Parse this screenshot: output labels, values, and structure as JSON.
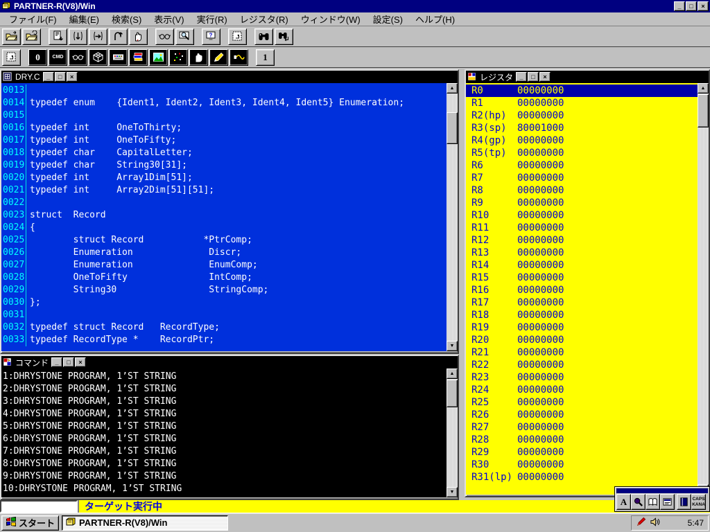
{
  "app": {
    "title": "PARTNER-R(V8)/Win"
  },
  "window_controls": {
    "minimize": "_",
    "maximize": "□",
    "restore": "□",
    "close": "×"
  },
  "menu": {
    "items": [
      {
        "name": "file",
        "label": "ファイル(F)"
      },
      {
        "name": "edit",
        "label": "編集(E)"
      },
      {
        "name": "search",
        "label": "検索(S)"
      },
      {
        "name": "view",
        "label": "表示(V)"
      },
      {
        "name": "run",
        "label": "実行(R)"
      },
      {
        "name": "register",
        "label": "レジスタ(R)"
      },
      {
        "name": "window",
        "label": "ウィンドウ(W)"
      },
      {
        "name": "config",
        "label": "設定(S)"
      },
      {
        "name": "help",
        "label": "ヘルプ(H)"
      }
    ]
  },
  "toolbar_row1": {
    "buttons": [
      {
        "name": "open-file",
        "icon": "open-file-icon"
      },
      {
        "name": "reload-file",
        "icon": "reload-file-icon"
      },
      {
        "name": "download",
        "icon": "download-icon",
        "gap": true
      },
      {
        "name": "step-into",
        "icon": "step-into-icon"
      },
      {
        "name": "step-over",
        "icon": "step-over-icon"
      },
      {
        "name": "step-out",
        "icon": "step-out-icon"
      },
      {
        "name": "stop",
        "icon": "stop-hand-icon"
      },
      {
        "name": "watch",
        "icon": "watch-glasses-icon",
        "gap": true
      },
      {
        "name": "inspect",
        "icon": "inspect-magnifier-icon"
      },
      {
        "name": "monitor-help",
        "icon": "monitor-help-icon",
        "gap": true
      },
      {
        "name": "window-layout",
        "icon": "window-layout-icon",
        "gap": true
      },
      {
        "name": "find",
        "icon": "find-binoculars-icon",
        "gap": true
      },
      {
        "name": "find-next",
        "icon": "find-next-icon"
      }
    ]
  },
  "toolbar_row2": {
    "buttons": [
      {
        "name": "window-layout-2",
        "icon": "window-layout-icon"
      },
      {
        "name": "zero-view",
        "label": "0",
        "dark": true,
        "gap": true
      },
      {
        "name": "command-view",
        "label": "CMD",
        "tiny": true,
        "dark": true
      },
      {
        "name": "watch-view",
        "icon": "watch-dark-icon",
        "dark": true
      },
      {
        "name": "memory-view",
        "icon": "memory-mesh-icon",
        "dark": true
      },
      {
        "name": "dump-view",
        "icon": "dump-keyboard-icon",
        "dark": true
      },
      {
        "name": "register-view",
        "icon": "register-books-icon",
        "dark": true
      },
      {
        "name": "bitmap-view",
        "icon": "bitmap-landscape-icon",
        "dark": true
      },
      {
        "name": "trace-view",
        "icon": "trace-dots-icon",
        "dark": true
      },
      {
        "name": "break-view",
        "icon": "hand-dark-icon",
        "dark": true
      },
      {
        "name": "edit-view",
        "icon": "edit-pencil-icon",
        "dark": true
      },
      {
        "name": "io-view",
        "icon": "io-ribbon-icon",
        "dark": true
      },
      {
        "name": "one-view",
        "label": "1",
        "gap": true
      }
    ]
  },
  "source_window": {
    "title": "DRY.C",
    "lines": [
      {
        "no": "0013",
        "code": ""
      },
      {
        "no": "0014",
        "code": "typedef enum    {Ident1, Ident2, Ident3, Ident4, Ident5} Enumeration;"
      },
      {
        "no": "0015",
        "code": ""
      },
      {
        "no": "0016",
        "code": "typedef int     OneToThirty;"
      },
      {
        "no": "0017",
        "code": "typedef int     OneToFifty;"
      },
      {
        "no": "0018",
        "code": "typedef char    CapitalLetter;"
      },
      {
        "no": "0019",
        "code": "typedef char    String30[31];"
      },
      {
        "no": "0020",
        "code": "typedef int     Array1Dim[51];"
      },
      {
        "no": "0021",
        "code": "typedef int     Array2Dim[51][51];"
      },
      {
        "no": "0022",
        "code": ""
      },
      {
        "no": "0023",
        "code": "struct  Record"
      },
      {
        "no": "0024",
        "code": "{"
      },
      {
        "no": "0025",
        "code": "        struct Record           *PtrComp;"
      },
      {
        "no": "0026",
        "code": "        Enumeration              Discr;"
      },
      {
        "no": "0027",
        "code": "        Enumeration              EnumComp;"
      },
      {
        "no": "0028",
        "code": "        OneToFifty               IntComp;"
      },
      {
        "no": "0029",
        "code": "        String30                 StringComp;"
      },
      {
        "no": "0030",
        "code": "};"
      },
      {
        "no": "0031",
        "code": ""
      },
      {
        "no": "0032",
        "code": "typedef struct Record   RecordType;"
      },
      {
        "no": "0033",
        "code": "typedef RecordType *    RecordPtr;"
      }
    ]
  },
  "command_window": {
    "title": "コマンド",
    "lines": [
      "1:DHRYSTONE PROGRAM, 1’ST STRING",
      "2:DHRYSTONE PROGRAM, 1’ST STRING",
      "3:DHRYSTONE PROGRAM, 1’ST STRING",
      "4:DHRYSTONE PROGRAM, 1’ST STRING",
      "5:DHRYSTONE PROGRAM, 1’ST STRING",
      "6:DHRYSTONE PROGRAM, 1’ST STRING",
      "7:DHRYSTONE PROGRAM, 1’ST STRING",
      "8:DHRYSTONE PROGRAM, 1’ST STRING",
      "9:DHRYSTONE PROGRAM, 1’ST STRING",
      "10:DHRYSTONE PROGRAM, 1’ST STRING"
    ]
  },
  "register_window": {
    "title": "レジスタ",
    "registers": [
      {
        "name": "R0",
        "value": "00000000",
        "selected": true
      },
      {
        "name": "R1",
        "value": "00000000"
      },
      {
        "name": "R2(hp)",
        "value": "00000000"
      },
      {
        "name": "R3(sp)",
        "value": "80001000"
      },
      {
        "name": "R4(gp)",
        "value": "00000000"
      },
      {
        "name": "R5(tp)",
        "value": "00000000"
      },
      {
        "name": "R6",
        "value": "00000000"
      },
      {
        "name": "R7",
        "value": "00000000"
      },
      {
        "name": "R8",
        "value": "00000000"
      },
      {
        "name": "R9",
        "value": "00000000"
      },
      {
        "name": "R10",
        "value": "00000000"
      },
      {
        "name": "R11",
        "value": "00000000"
      },
      {
        "name": "R12",
        "value": "00000000"
      },
      {
        "name": "R13",
        "value": "00000000"
      },
      {
        "name": "R14",
        "value": "00000000"
      },
      {
        "name": "R15",
        "value": "00000000"
      },
      {
        "name": "R16",
        "value": "00000000"
      },
      {
        "name": "R17",
        "value": "00000000"
      },
      {
        "name": "R18",
        "value": "00000000"
      },
      {
        "name": "R19",
        "value": "00000000"
      },
      {
        "name": "R20",
        "value": "00000000"
      },
      {
        "name": "R21",
        "value": "00000000"
      },
      {
        "name": "R22",
        "value": "00000000"
      },
      {
        "name": "R23",
        "value": "00000000"
      },
      {
        "name": "R24",
        "value": "00000000"
      },
      {
        "name": "R25",
        "value": "00000000"
      },
      {
        "name": "R26",
        "value": "00000000"
      },
      {
        "name": "R27",
        "value": "00000000"
      },
      {
        "name": "R28",
        "value": "00000000"
      },
      {
        "name": "R29",
        "value": "00000000"
      },
      {
        "name": "R30",
        "value": "00000000"
      },
      {
        "name": "R31(lp)",
        "value": "00000000"
      }
    ]
  },
  "status_bar": {
    "input_value": "",
    "message": "ターゲット実行中"
  },
  "ime_toolbar": {
    "input_mode_label": "A",
    "caps_label": "CAPS",
    "kana_label": "KANA",
    "icons": [
      "input-mode",
      "ime-magnifier-icon",
      "ime-dictionary-book-icon",
      "ime-properties-icon",
      "ime-wordbook-icon",
      "caps-kana-indicator"
    ]
  },
  "taskbar": {
    "start_label": "スタート",
    "task_label": "PARTNER-R(V8)/Win",
    "clock": "5:47"
  },
  "colors": {
    "main_title_bg": "#000080",
    "child_title_bg": "#000000",
    "source_bg": "#0030DC",
    "source_text": "#FFFFFF",
    "line_number": "#00FFFF",
    "command_bg": "#000000",
    "command_text": "#FFFFFF",
    "register_bg": "#FFFF00",
    "register_text": "#0000D0",
    "selected_register_bg": "#0000A8",
    "selected_register_text": "#FFFF00",
    "status_bg": "#FFFF00",
    "status_text": "#0000E0",
    "chrome": "#C0C0C0"
  }
}
